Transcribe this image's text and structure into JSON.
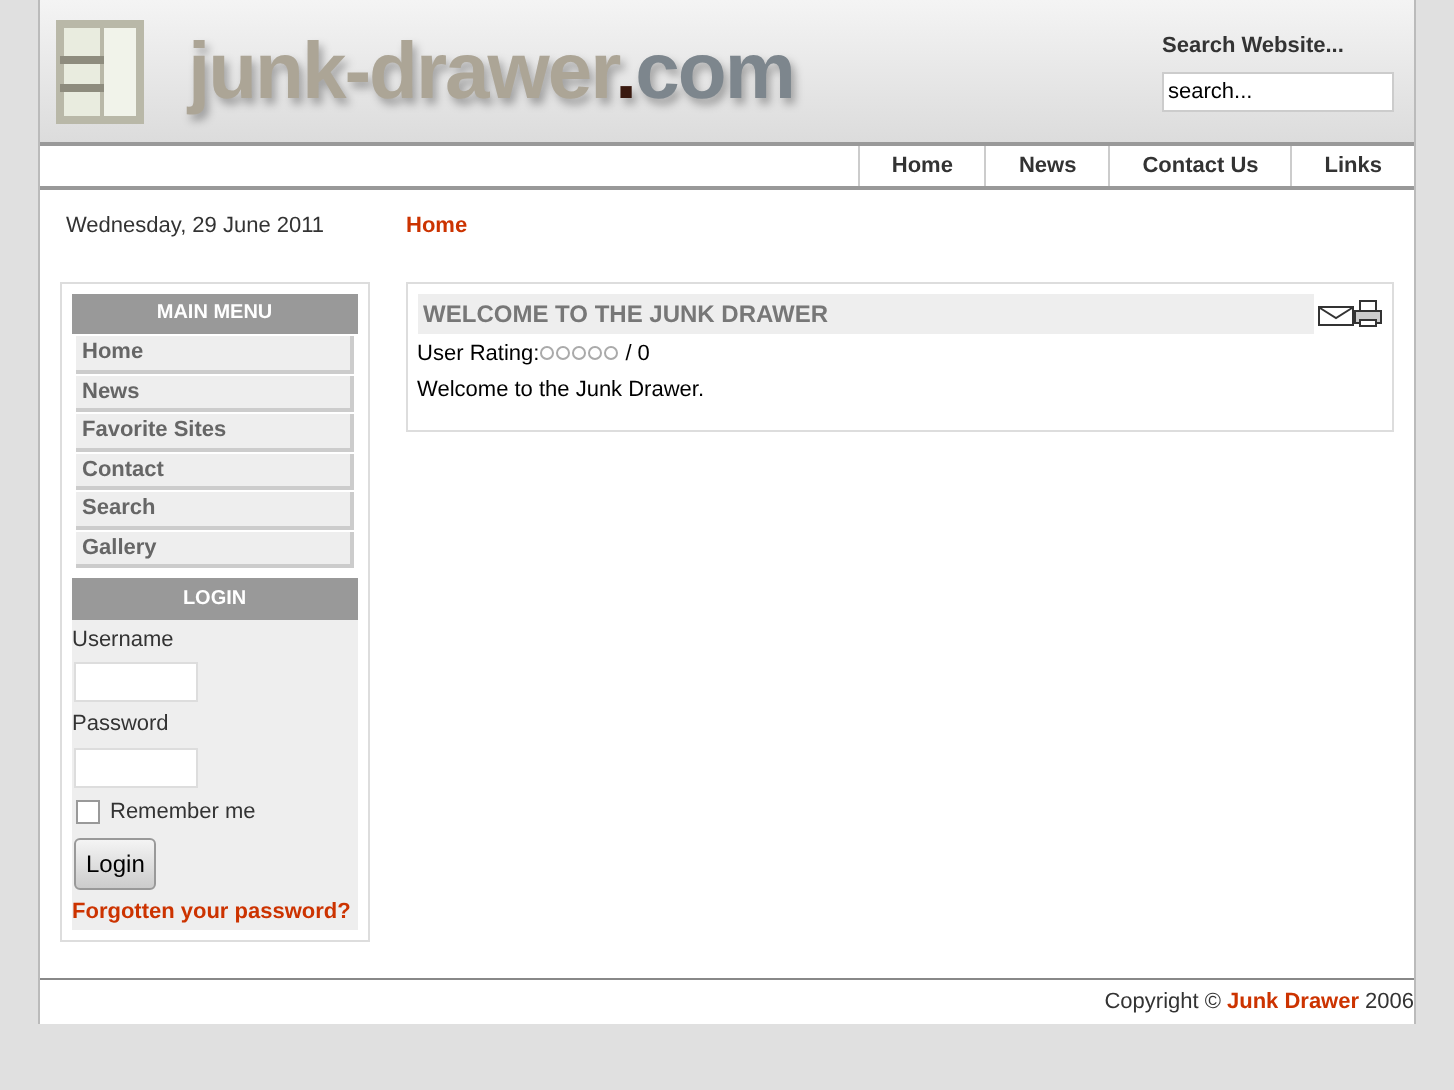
{
  "header": {
    "logo": {
      "name": "junk-drawer",
      "dot": ".",
      "tld": "com"
    },
    "search_label": "Search Website...",
    "search": {
      "value": "search..."
    }
  },
  "nav": [
    {
      "label": "Home"
    },
    {
      "label": "News"
    },
    {
      "label": "Contact Us"
    },
    {
      "label": "Links"
    }
  ],
  "date": "Wednesday, 29 June 2011",
  "breadcrumb": "Home",
  "main_menu": {
    "title": "MAIN MENU",
    "items": [
      {
        "label": "Home"
      },
      {
        "label": "News"
      },
      {
        "label": "Favorite Sites"
      },
      {
        "label": "Contact"
      },
      {
        "label": "Search"
      },
      {
        "label": "Gallery"
      }
    ]
  },
  "login": {
    "title": "LOGIN",
    "username_label": "Username",
    "password_label": "Password",
    "remember": {
      "label": "Remember me",
      "checked": false
    },
    "button": "Login",
    "forgot_link": "Forgotten your password?"
  },
  "article": {
    "title": "WELCOME TO THE JUNK DRAWER",
    "rating_label": "User Rating:",
    "stars": 0,
    "rating_count": "/ 0",
    "body": "Welcome to the Junk Drawer."
  },
  "footer": {
    "prefix": "Copyright ©",
    "link": "Junk Drawer",
    "suffix": "2006"
  }
}
